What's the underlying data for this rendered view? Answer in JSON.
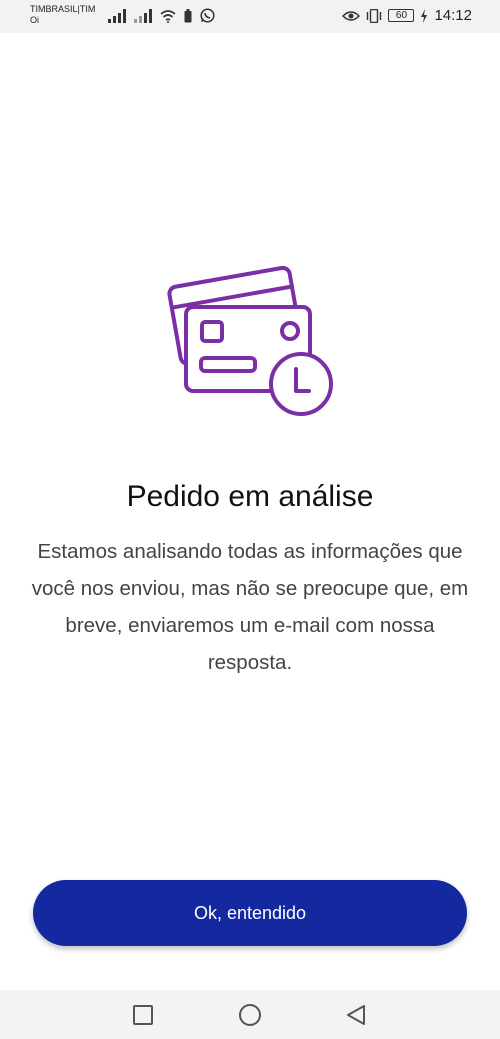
{
  "status_bar": {
    "carrier_primary": "TIMBRASIL|TIM",
    "carrier_secondary": "Oi",
    "battery_level": "60",
    "time": "14:12",
    "icons": [
      "signal-icon",
      "signal-icon",
      "wifi-icon",
      "battery-saver-icon",
      "whatsapp-icon",
      "eye-icon",
      "vibrate-icon",
      "battery-icon",
      "charging-icon"
    ]
  },
  "illustration": {
    "icon": "credit-card-clock-icon",
    "color": "#7b2fa6"
  },
  "content": {
    "title": "Pedido em análise",
    "description": "Estamos analisando todas as informações que você nos enviou, mas não se preocupe que, em breve, enviaremos um e-mail com nossa resposta."
  },
  "actions": {
    "ok_label": "Ok, entendido",
    "button_color": "#1428a0"
  },
  "nav_bar": {
    "buttons": [
      "recent-apps-icon",
      "home-icon",
      "back-icon"
    ]
  }
}
